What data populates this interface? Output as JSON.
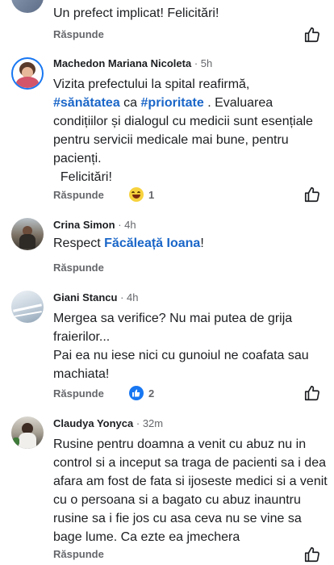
{
  "comments": [
    {
      "name": "",
      "time": "",
      "text": "Un prefect implicat! Felicitări!",
      "reply": "Răspunde"
    },
    {
      "name": "Machedon Mariana Nicoleta",
      "time": "5h",
      "text_parts": [
        "Vizita prefectului la spital reafirmă,\n",
        "#sănătatea",
        " ca ",
        "#prioritate",
        " . Evaluarea condițiilor și dialogul cu medicii sunt esențiale pentru servicii medicale mai bune, pentru pacienți.\n  Felicitări!"
      ],
      "reply": "Răspunde",
      "reaction_icon": "laughing-emoji-icon",
      "reaction_count": "1"
    },
    {
      "name": "Crina Simon",
      "time": "4h",
      "text_parts": [
        "Respect ",
        "Făcăleață Ioana",
        "!"
      ],
      "reply": "Răspunde"
    },
    {
      "name": "Giani Stancu",
      "time": "4h",
      "text": "Mergea sa verifice? Nu mai putea de grija fraierilor...\nPai ea nu iese nici cu gunoiul ne coafata sau machiata!",
      "reply": "Răspunde",
      "reaction_icon": "thumbs-up-icon",
      "reaction_count": "2"
    },
    {
      "name": "Claudya Yonyca",
      "time": "32m",
      "text": "Rusine pentru doamna a venit cu abuz nu in control si a inceput sa traga de pacienti sa i dea afara am fost de fata si ijoseste medici si a venit cu o persoana si a bagato cu abuz inauntru rusine sa i fie jos cu asa ceva nu se vine sa bage lume. Ca ezte ea jmechera",
      "reply": "Răspunde"
    }
  ],
  "colors": {
    "link": "#1a66c8",
    "meta": "#65676b",
    "text": "#1c1e21",
    "like": "#1877f2"
  }
}
